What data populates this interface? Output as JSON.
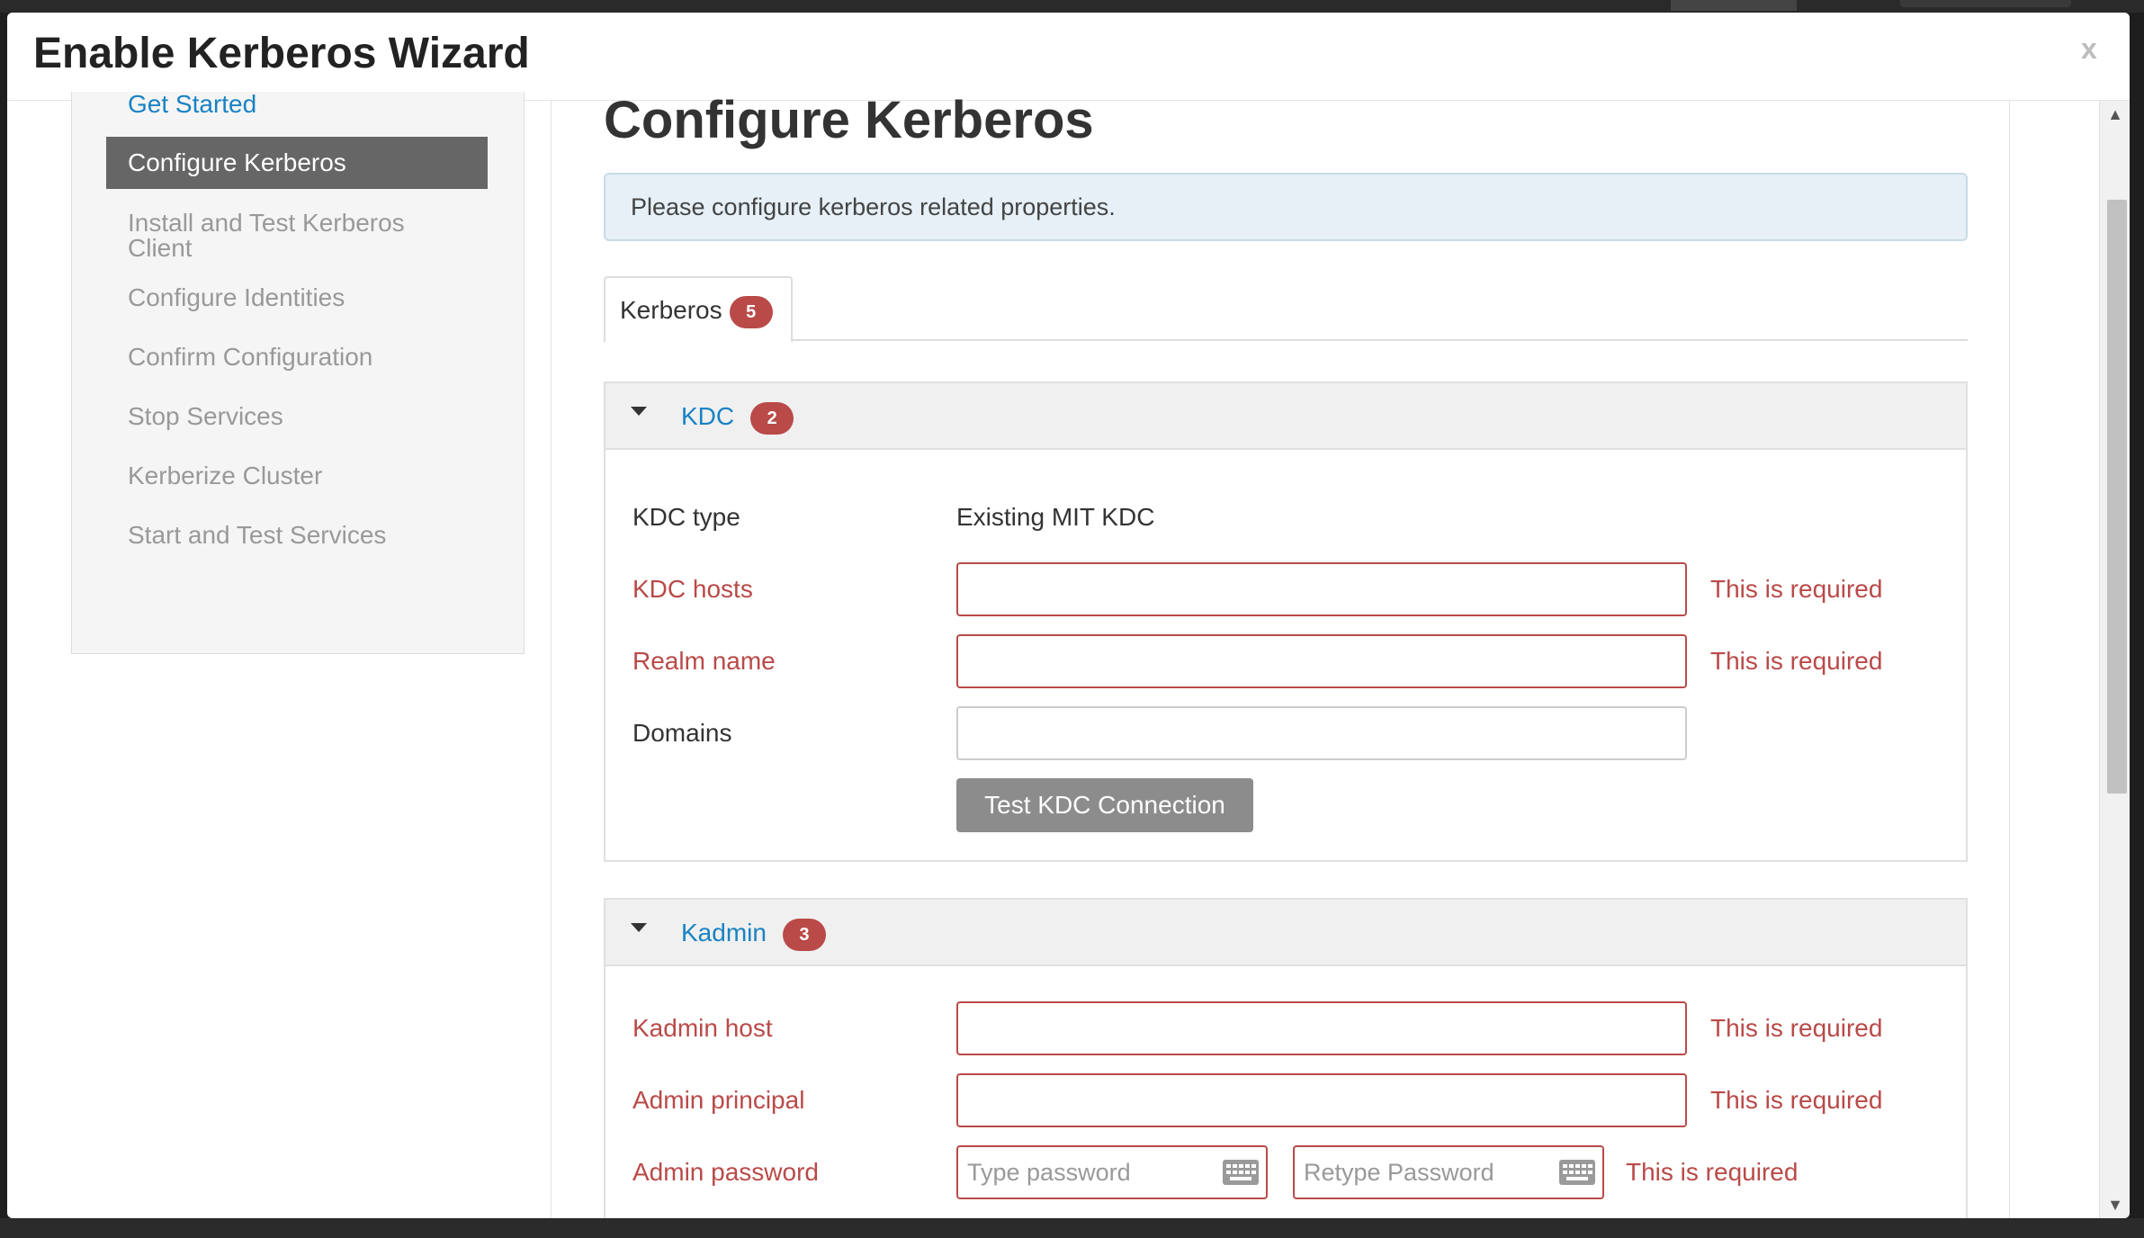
{
  "modal": {
    "title": "Enable Kerberos Wizard",
    "close_label": "x"
  },
  "steps": [
    {
      "label": "Get Started",
      "state": "done"
    },
    {
      "label": "Configure Kerberos",
      "state": "active"
    },
    {
      "label": "Install and Test Kerberos\nClient",
      "state": "pending"
    },
    {
      "label": "Configure Identities",
      "state": "pending"
    },
    {
      "label": "Confirm Configuration",
      "state": "pending"
    },
    {
      "label": "Stop Services",
      "state": "pending"
    },
    {
      "label": "Kerberize Cluster",
      "state": "pending"
    },
    {
      "label": "Start and Test Services",
      "state": "pending"
    }
  ],
  "main": {
    "title": "Configure Kerberos",
    "alert": "Please configure kerberos related properties.",
    "tab": {
      "label": "Kerberos",
      "badge": "5"
    }
  },
  "kdc": {
    "title": "KDC",
    "badge": "2",
    "kdc_type_label": "KDC type",
    "kdc_type_value": "Existing MIT KDC",
    "hosts_label": "KDC hosts",
    "hosts_value": "",
    "hosts_error": "This is required",
    "realm_label": "Realm name",
    "realm_value": "",
    "realm_error": "This is required",
    "domains_label": "Domains",
    "domains_value": "",
    "test_button": "Test KDC Connection"
  },
  "kadmin": {
    "title": "Kadmin",
    "badge": "3",
    "host_label": "Kadmin host",
    "host_value": "",
    "host_error": "This is required",
    "principal_label": "Admin principal",
    "principal_value": "",
    "principal_error": "This is required",
    "password_label": "Admin password",
    "password_placeholder": "Type password",
    "retype_placeholder": "Retype Password",
    "password_error": "This is required"
  },
  "colors": {
    "error": "#b94a48",
    "link": "#1a82c3",
    "active_step_bg": "#666666",
    "badge": "#b94a48"
  }
}
